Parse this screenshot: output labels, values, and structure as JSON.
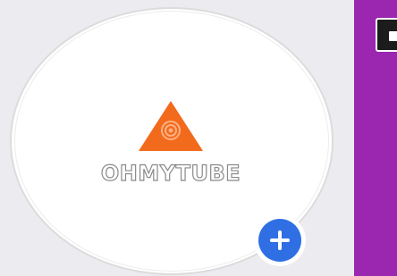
{
  "avatar": {
    "logo_icon": "orange-triangle-logo-icon",
    "logo_text": "OHMYTUBE",
    "colors": {
      "logo_orange": "#f26a1b",
      "accent_blue": "#2f6fe3",
      "side_purple": "#9b27b1"
    }
  },
  "add_button": {
    "icon": "plus-icon"
  },
  "side_panel": {
    "icon": "app-tile-icon"
  }
}
